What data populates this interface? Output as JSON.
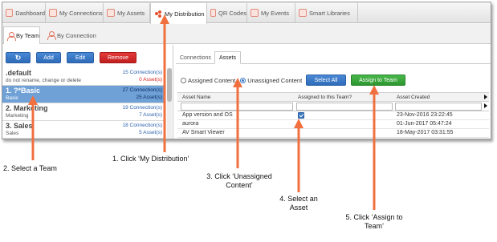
{
  "top_tabs": [
    {
      "label": "Dashboard",
      "icon": "dashboard-icon"
    },
    {
      "label": "My Connections",
      "icon": "connections-icon"
    },
    {
      "label": "My Assets",
      "icon": "assets-icon"
    },
    {
      "label": "My Distribution",
      "icon": "distribution-icon",
      "active": true
    },
    {
      "label": "QR Codes",
      "icon": "qr-code-icon"
    },
    {
      "label": "My Events",
      "icon": "events-icon"
    },
    {
      "label": "Smart Libraries",
      "icon": "libraries-icon"
    }
  ],
  "sub_tabs": [
    {
      "label": "By Team",
      "icon": "team-icon",
      "active": true
    },
    {
      "label": "By Connection",
      "icon": "person-icon"
    }
  ],
  "toolbar": {
    "refresh_icon": "refresh-icon",
    "add_label": "Add",
    "edit_label": "Edit",
    "remove_label": "Remove"
  },
  "teams": [
    {
      "name": ".default",
      "subtitle": "do not rename, change or delete",
      "connections": "15 Connection(s)",
      "assets": "0 Asset(s)",
      "selected": false
    },
    {
      "name": "1. ?*Basic",
      "subtitle": "Basic",
      "connections": "27 Connection(s)",
      "assets": "25 Asset(s)",
      "selected": true
    },
    {
      "name": "2. Marketing",
      "subtitle": "Marketing",
      "connections": "19 Connection(s)",
      "assets": "7 Asset(s)",
      "selected": false
    },
    {
      "name": "3. Sales",
      "subtitle": "Sales",
      "connections": "18 Connection(s)",
      "assets": "5 Asset(s)",
      "selected": false
    }
  ],
  "right_tabs": [
    {
      "label": "Connections",
      "active": false
    },
    {
      "label": "Assets",
      "active": true
    }
  ],
  "filter": {
    "assigned_label": "Assigned Content",
    "unassigned_label": "Unassigned Content",
    "selected": "unassigned"
  },
  "buttons": {
    "select_all": "Select All",
    "assign_to_team": "Assign to Team"
  },
  "grid": {
    "columns": [
      "Asset Name",
      "Assigned to this Team?",
      "Asset Created"
    ],
    "rows": [
      {
        "name": "App version and OS",
        "checked": true,
        "created": "23-Nov-2016 23:22:45"
      },
      {
        "name": "aurora",
        "checked": false,
        "created": "01-Jun-2017 05:47:24"
      },
      {
        "name": "AV Smart Viewer",
        "checked": false,
        "created": "18-May-2017 03:31:55"
      }
    ]
  },
  "callouts": {
    "c1": "1. Click ‘My Distribution’",
    "c2": "2. Select a Team",
    "c3a": "3. Click ‘Unassigned",
    "c3b": "Content’",
    "c4a": "4. Select an",
    "c4b": "Asset",
    "c5a": "5. Click ‘Assign to",
    "c5b": "Team’"
  },
  "colors": {
    "callout_arrow": "#f0703f",
    "selected_row": "#6fa1d6",
    "primary_button": "#2e6bb8",
    "danger_button": "#c01e1e",
    "success_button": "#2d962f"
  }
}
